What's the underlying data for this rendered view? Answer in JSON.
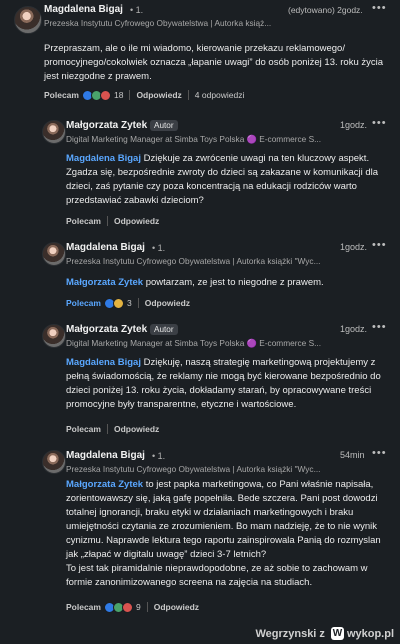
{
  "top": {
    "name": "Magdalena Bigaj",
    "degree": "• 1.",
    "subtitle": "Prezeska Instytutu Cyfrowego Obywatelstwa | Autorka książ...",
    "edited": "(edytowano) 2godz.",
    "text": "Przepraszam, ale o ile mi wiadomo, kierowanie przekazu reklamowego/ promocyjnego/cokolwiek oznacza „łapanie uwagi” do osób poniżej 13. roku życia jest niezgodne z prawem.",
    "like_label": "Polecam",
    "reaction_count": "18",
    "reply_label": "Odpowiedz",
    "reply_count": "4 odpowiedzi"
  },
  "replies": [
    {
      "name": "Małgorzata Zytek",
      "badge": "Autor",
      "subtitle": "Digital Marketing Manager at Simba Toys Polska 🟣 E-commerce S...",
      "time": "1godz.",
      "mention": "Magdalena Bigaj",
      "text": " Dziękuje za zwrócenie uwagi na ten kluczowy aspekt. Zgadza się, bezpośrednie zwroty do dzieci są zakazane w komunikacji dla dzieci, zaś pytanie czy poza koncentracją na edukacji rodziców warto przedstawiać zabawki dzieciom?",
      "like_label": "Polecam",
      "reply_label": "Odpowiedz"
    },
    {
      "name": "Magdalena Bigaj",
      "degree": "• 1.",
      "subtitle": "Prezeska Instytutu Cyfrowego Obywatelstwa | Autorka książki \"Wyc...",
      "time": "1godz.",
      "mention": "Małgorzata Zytek",
      "text": " powtarzam, ze jest to niegodne z prawem.",
      "like_label": "Polecam",
      "reaction_count": "3",
      "reply_label": "Odpowiedz"
    },
    {
      "name": "Małgorzata Zytek",
      "badge": "Autor",
      "subtitle": "Digital Marketing Manager at Simba Toys Polska 🟣 E-commerce S...",
      "time": "1godz.",
      "mention": "Magdalena Bigaj",
      "text": " Dziękuję, naszą strategię marketingową projektujemy z pełną świadomością, że reklamy nie mogą być kierowane bezpośrednio do dzieci poniżej 13. roku życia, dokładamy starań, by opracowywane treści promocyjne były transparentne, etyczne i wartościowe.",
      "like_label": "Polecam",
      "reply_label": "Odpowiedz"
    },
    {
      "name": "Magdalena Bigaj",
      "degree": "• 1.",
      "subtitle": "Prezeska Instytutu Cyfrowego Obywatelstwa | Autorka książki \"Wyc...",
      "time": "54min",
      "mention": "Małgorzata Zytek",
      "text": " to jest papka marketingowa, co Pani właśnie napisała, zorientowawszy się, jaką gafę popełniła. Bede szczera. Pani post dowodzi totalnej ignorancji, braku etyki w działaniach marketingowych i braku umiejętności czytania ze zrozumieniem. Bo mam nadzieję, że to nie wynik cynizmu. Naprawde lektura tego raportu zainspirowala Panią do rozmyslan jak „złapać w digitalu uwagę” dzieci 3-7 letnich?",
      "text2": "To jest tak piramidalnie nieprawdopodobne, ze aż sobie to zachowam w formie zanonimizowanego screena na zajęcia na studiach.",
      "like_label": "Polecam",
      "reaction_count": "9",
      "reply_label": "Odpowiedz"
    }
  ],
  "footer": {
    "user": "Wegrzynski z",
    "site": "wykop.pl",
    "logo_letter": "W"
  }
}
